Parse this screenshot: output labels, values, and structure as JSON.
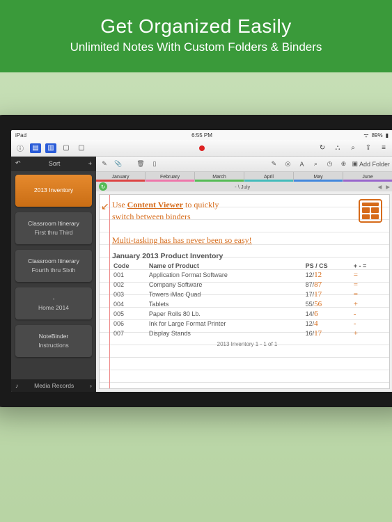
{
  "banner": {
    "title": "Get Organized Easily",
    "subtitle": "Unlimited Notes With Custom Folders & Binders"
  },
  "status": {
    "device": "iPad",
    "wifi": "᷾",
    "time": "6:55 PM",
    "battery": "89%"
  },
  "toolbar": {
    "info": "ⓘ",
    "sync": "↻",
    "people": "👥",
    "search": "🔍",
    "share": "⇪",
    "more": "☰"
  },
  "sidebar": {
    "undo_icon": "↶",
    "sort_label": "Sort",
    "add_icon": "+",
    "items": [
      {
        "t1": "2013 Inventory",
        "t2": "",
        "active": true
      },
      {
        "t1": "Classroom Itinerary",
        "t2": "First thru Third"
      },
      {
        "t1": "Classroom Itinerary",
        "t2": "Fourth thru Sixth"
      },
      {
        "t1": "-",
        "t2": "Home\n2014"
      },
      {
        "t1": "NoteBinder",
        "t2": "Instructions"
      }
    ],
    "bottom_icon": "♪",
    "bottom_label": "Media Records",
    "bottom_chevron": "›"
  },
  "viewer": {
    "tools_left": [
      "✎",
      "📎",
      "🗑",
      "📄"
    ],
    "tools_right": [
      "✎",
      "📷",
      "A",
      "🔍",
      "⏱",
      "⊕"
    ],
    "add_folder_label": "Add Folder",
    "tabs": [
      "January",
      "February",
      "March",
      "April",
      "May",
      "June",
      "- / July"
    ],
    "crumb": "- \\ July",
    "refresh_icon": "↻",
    "nav_left": "◀",
    "nav_right": "▶"
  },
  "note": {
    "arrow": "↙",
    "line1_a": "Use ",
    "line1_u": "Content Viewer",
    "line1_b": " to quickly",
    "line2": "switch between binders",
    "line3": "Multi-tasking has has never been so easy!",
    "inv_title": "January 2013 Product Inventory",
    "cols": {
      "code": "Code",
      "name": "Name of Product",
      "pscs": "PS / CS",
      "pm": "+ - ="
    },
    "rows": [
      {
        "code": "001",
        "name": "Application Format Software",
        "ps": "12/",
        "cs": "12",
        "op": "="
      },
      {
        "code": "002",
        "name": "Company Software",
        "ps": "87/",
        "cs": "87",
        "op": "="
      },
      {
        "code": "003",
        "name": "Towers iMac Quad",
        "ps": "17/",
        "cs": "17",
        "op": "="
      },
      {
        "code": "004",
        "name": "Tablets",
        "ps": "55/",
        "cs": "56",
        "op": "+"
      },
      {
        "code": "005",
        "name": "Paper Rolls 80 Lb.",
        "ps": "14/",
        "cs": "6",
        "op": "-"
      },
      {
        "code": "006",
        "name": "Ink for Large Format Printer",
        "ps": "12/",
        "cs": "4",
        "op": "-"
      },
      {
        "code": "007",
        "name": "Display Stands",
        "ps": "16/",
        "cs": "17",
        "op": "+"
      }
    ],
    "footer": "2013 Inventory  1 - 1 of 1"
  }
}
